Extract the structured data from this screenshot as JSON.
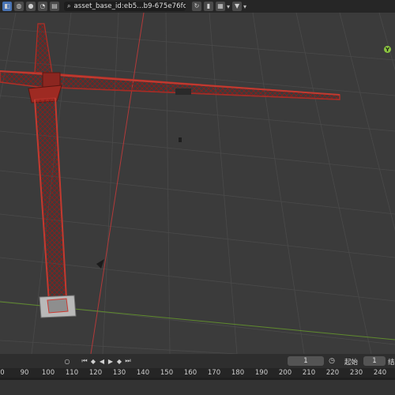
{
  "header": {
    "search_value": "asset_base_id:eb5...b9-675e76fcdac9",
    "icons": [
      "toggle-icon",
      "globe-icon",
      "sphere-icon",
      "recent-icon",
      "folder-icon",
      "search-icon",
      "refresh-icon",
      "bookmark-icon",
      "view-icon",
      "filter-icon"
    ]
  },
  "viewport": {
    "gizmo_axis_label": "Y"
  },
  "timeline": {
    "current_frame": "1",
    "start_label": "起始",
    "start_value": "1",
    "end_label": "结",
    "ruler_ticks": [
      "0",
      "90",
      "100",
      "110",
      "120",
      "130",
      "140",
      "150",
      "160",
      "170",
      "180",
      "190",
      "200",
      "210",
      "220",
      "230",
      "240"
    ]
  }
}
